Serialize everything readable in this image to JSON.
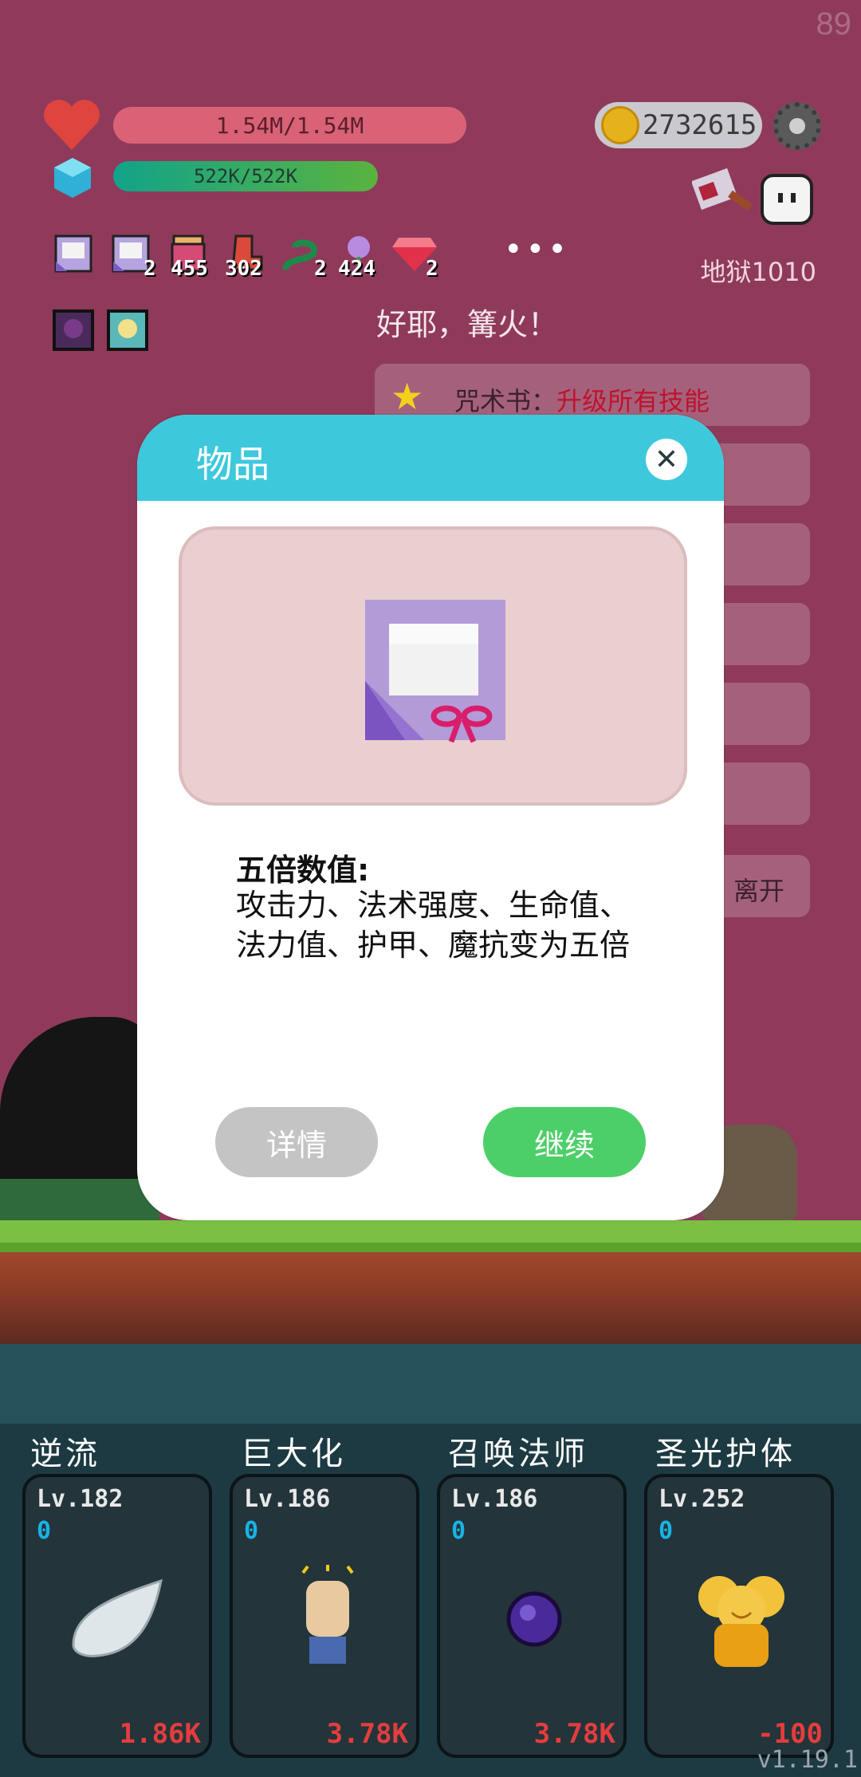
{
  "fps": "89",
  "hud": {
    "hp_text": "1.54M/1.54M",
    "mp_text": "522K/522K",
    "gold": "2732615",
    "floor": "地狱1010",
    "more": "•••",
    "inventory": [
      {
        "icon": "gift-box-icon",
        "count": ""
      },
      {
        "icon": "gift-box-icon",
        "count": "2"
      },
      {
        "icon": "jar-icon",
        "count": "455"
      },
      {
        "icon": "boot-icon",
        "count": "302"
      },
      {
        "icon": "snake-icon",
        "count": "2"
      },
      {
        "icon": "flower-icon",
        "count": "424"
      },
      {
        "icon": "ruby-icon",
        "count": "2"
      }
    ]
  },
  "message": "好耶，篝火！",
  "quests": [
    {
      "prefix": "咒术书：",
      "highlight": "升级所有技能"
    },
    {
      "prefix": "",
      "highlight": ""
    },
    {
      "prefix": "",
      "highlight": ""
    },
    {
      "prefix": "",
      "highlight": ""
    },
    {
      "prefix": "",
      "highlight": ""
    },
    {
      "prefix": "",
      "highlight": ""
    },
    {
      "prefix": "离开",
      "highlight": ""
    }
  ],
  "modal": {
    "title": "物品",
    "close": "✕",
    "desc_head": "五倍数值:",
    "desc_body": "攻击力、法术强度、生命值、法力值、护甲、魔抗变为五倍",
    "detail_btn": "详情",
    "continue_btn": "继续"
  },
  "skills": [
    {
      "name": "逆流",
      "lv": "Lv.182",
      "zero": "0",
      "cost": "1.86K",
      "icon": "cloud-wing-icon"
    },
    {
      "name": "巨大化",
      "lv": "Lv.186",
      "zero": "0",
      "cost": "3.78K",
      "icon": "fist-icon"
    },
    {
      "name": "召唤法师",
      "lv": "Lv.186",
      "zero": "0",
      "cost": "3.78K",
      "icon": "dark-orb-icon"
    },
    {
      "name": "圣光护体",
      "lv": "Lv.252",
      "zero": "0",
      "cost": "-100",
      "icon": "golden-angel-icon"
    }
  ],
  "version": "v1.19.1",
  "colors": {
    "bg": "#8f3a5b",
    "accent": "#3ec8dc",
    "continue": "#4ccf68"
  }
}
